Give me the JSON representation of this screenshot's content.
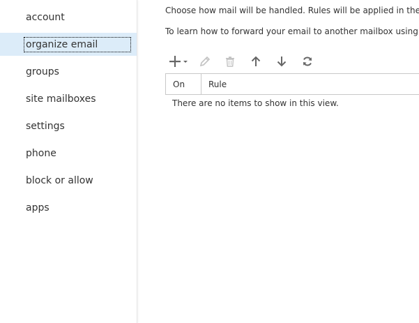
{
  "sidebar": {
    "items": [
      {
        "label": "account",
        "selected": false
      },
      {
        "label": "organize email",
        "selected": true
      },
      {
        "label": "groups",
        "selected": false
      },
      {
        "label": "site mailboxes",
        "selected": false
      },
      {
        "label": "settings",
        "selected": false
      },
      {
        "label": "phone",
        "selected": false
      },
      {
        "label": "block or allow",
        "selected": false
      },
      {
        "label": "apps",
        "selected": false
      }
    ]
  },
  "main": {
    "description_line1": "Choose how mail will be handled. Rules will be applied in the order sh",
    "description_line2": "To learn how to forward your email to another mailbox using Inbox ru",
    "toolbar": {
      "icons": [
        "add-icon",
        "edit-icon",
        "delete-icon",
        "move-up-icon",
        "move-down-icon",
        "refresh-icon"
      ]
    },
    "table": {
      "columns": [
        "On",
        "Rule"
      ],
      "empty_message": "There are no items to show in this view."
    }
  },
  "colors": {
    "selected_bg": "#dcecf9",
    "icon_active": "#666666",
    "icon_disabled": "#c2c2c2",
    "border": "#c8c8c8"
  }
}
